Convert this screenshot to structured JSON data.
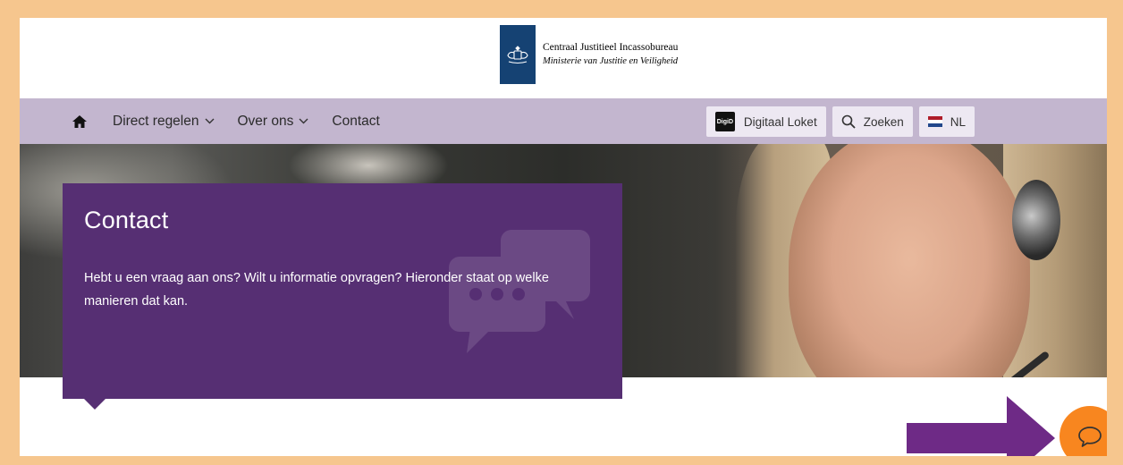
{
  "header": {
    "org_name": "Centraal Justitieel Incassobureau",
    "ministry": "Ministerie van Justitie en Veiligheid",
    "logo_icon": "coat-of-arms-icon"
  },
  "nav": {
    "home_icon": "home-icon",
    "items": [
      {
        "label": "Direct regelen",
        "has_dropdown": true
      },
      {
        "label": "Over ons",
        "has_dropdown": true
      },
      {
        "label": "Contact",
        "has_dropdown": false
      }
    ],
    "buttons": {
      "digid_badge": "DigiD",
      "digid_label": "Digitaal Loket",
      "search_label": "Zoeken",
      "language_label": "NL"
    }
  },
  "hero": {
    "title": "Contact",
    "text": "Hebt u een vraag aan ons? Wilt u informatie opvragen? Hieronder staat op welke manieren dat kan."
  },
  "colors": {
    "nav_bg": "#c3b6cf",
    "card_bg": "#562f73",
    "chat_button": "#f8861f",
    "arrow": "#6e2a86",
    "frame_border": "#f6c68e",
    "logo_bg": "#154273"
  }
}
